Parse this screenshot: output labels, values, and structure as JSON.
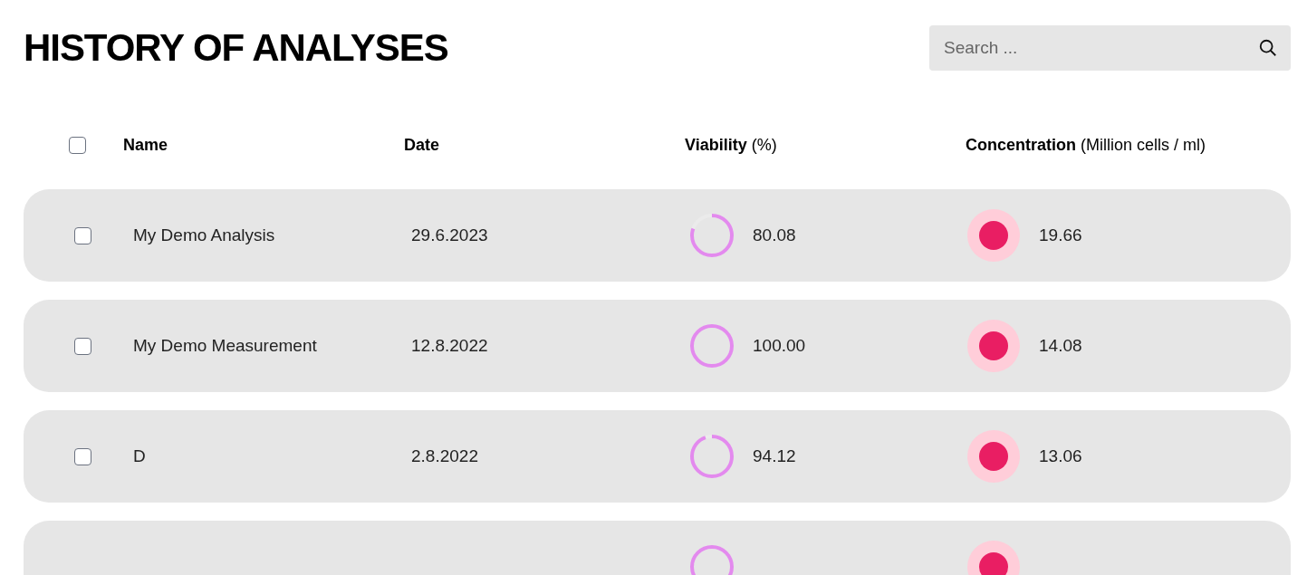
{
  "title": "HISTORY OF ANALYSES",
  "search": {
    "placeholder": "Search ..."
  },
  "header": {
    "select_all_checked": false,
    "columns": [
      "**Name**",
      "**Date**",
      "**Viability** (%)",
      "**Concentration** (Million cells / ml)"
    ]
  },
  "rows": [
    {
      "checked": false,
      "name": "My Demo Analysis",
      "date": "29.6.2023",
      "viability": {
        "level": 0.8008,
        "reading": "80.08"
      },
      "concentration": "19.66"
    },
    {
      "checked": false,
      "name": "My Demo Measurement",
      "date": "12.8.2022",
      "viability": {
        "level": 1.0,
        "reading": "100.00"
      },
      "concentration": "14.08"
    },
    {
      "checked": false,
      "name": "D",
      "date": "2.8.2022",
      "viability": {
        "level": 0.9412,
        "reading": "94.12"
      },
      "concentration": "13.06"
    },
    {
      "kind": "cut_off"
    }
  ]
}
